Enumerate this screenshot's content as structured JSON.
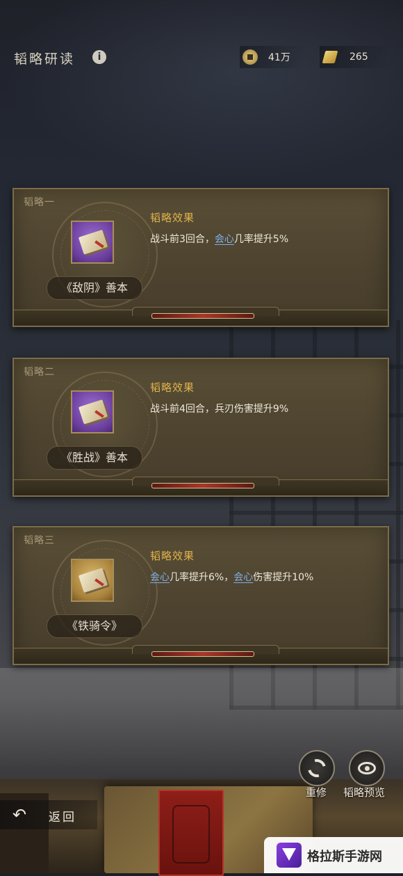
{
  "header": {
    "title": "韬略研读",
    "info_icon": "i",
    "coin_value": "41万",
    "scroll_value": "265"
  },
  "cards": [
    {
      "label": "韬略一",
      "item_name": "《敌阴》善本",
      "effect_title": "韬略效果",
      "effect_parts": [
        "战斗前3回合，",
        "会心",
        "几率提升5%"
      ]
    },
    {
      "label": "韬略二",
      "item_name": "《胜战》善本",
      "effect_title": "韬略效果",
      "effect_text": "战斗前4回合，兵刃伤害提升9%"
    },
    {
      "label": "韬略三",
      "item_name": "《铁骑令》",
      "effect_title": "韬略效果",
      "effect_parts": [
        "会心",
        "几率提升6%，",
        "会心",
        "伤害提升10%"
      ]
    }
  ],
  "actions": {
    "rebuild_label": "重修",
    "preview_label": "韬略预览",
    "back_label": "返回"
  },
  "watermark": {
    "text": "格拉斯手游网"
  },
  "colors": {
    "accent_gold": "#e0b34c",
    "keyword_blue": "#7fb0ea",
    "card_bg": "#4e4430"
  }
}
